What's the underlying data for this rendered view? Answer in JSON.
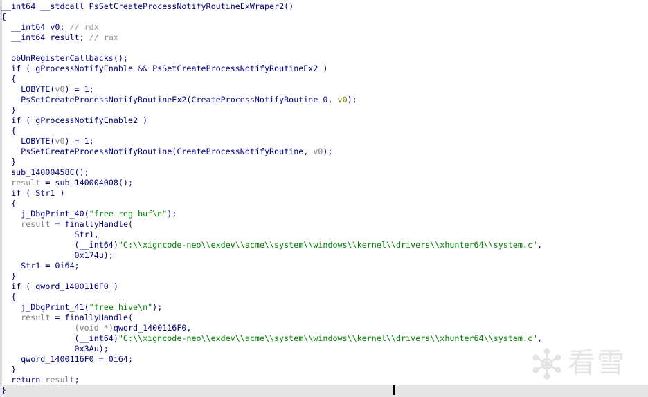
{
  "lines": [
    [
      [
        "k",
        "__int64 __stdcall PsSetCreateProcessNotifyRoutineExWraper2()"
      ]
    ],
    [
      [
        "k",
        "{"
      ]
    ],
    [
      [
        "k",
        "  __int64 v0; "
      ],
      [
        "c",
        "// rdx"
      ]
    ],
    [
      [
        "k",
        "  __int64 result; "
      ],
      [
        "c",
        "// rax"
      ]
    ],
    [
      [
        "k",
        ""
      ]
    ],
    [
      [
        "k",
        "  obUnRegisterCallbacks();"
      ]
    ],
    [
      [
        "k",
        "  if ( gProcessNotifyEnable && PsSetCreateProcessNotifyRoutineEx2 )"
      ]
    ],
    [
      [
        "k",
        "  {"
      ]
    ],
    [
      [
        "k",
        "    LOBYTE("
      ],
      [
        "v",
        "v0"
      ],
      [
        "k",
        ") = 1;"
      ]
    ],
    [
      [
        "k",
        "    PsSetCreateProcessNotifyRoutineEx2(CreateProcessNotifyRoutine_0, "
      ],
      [
        "n",
        "v0"
      ],
      [
        "k",
        ");"
      ]
    ],
    [
      [
        "k",
        "  }"
      ]
    ],
    [
      [
        "k",
        "  if ( gProcessNotifyEnable2 )"
      ]
    ],
    [
      [
        "k",
        "  {"
      ]
    ],
    [
      [
        "k",
        "    LOBYTE("
      ],
      [
        "v",
        "v0"
      ],
      [
        "k",
        ") = 1;"
      ]
    ],
    [
      [
        "k",
        "    PsSetCreateProcessNotifyRoutine(CreateProcessNotifyRoutine, "
      ],
      [
        "v",
        "v0"
      ],
      [
        "k",
        ");"
      ]
    ],
    [
      [
        "k",
        "  }"
      ]
    ],
    [
      [
        "k",
        "  sub_14000458C();"
      ]
    ],
    [
      [
        "k",
        "  "
      ],
      [
        "v",
        "result"
      ],
      [
        "k",
        " = sub_140004008();"
      ]
    ],
    [
      [
        "k",
        "  if ( Str1 )"
      ]
    ],
    [
      [
        "k",
        "  {"
      ]
    ],
    [
      [
        "k",
        "    j_DbgPrint_40("
      ],
      [
        "s",
        "\"free reg buf\\n\""
      ],
      [
        "k",
        ");"
      ]
    ],
    [
      [
        "k",
        "    "
      ],
      [
        "v",
        "result"
      ],
      [
        "k",
        " = finallyHandle("
      ]
    ],
    [
      [
        "k",
        "               Str1,"
      ]
    ],
    [
      [
        "k",
        "               (__int64)"
      ],
      [
        "s",
        "\"C:\\\\xigncode-neo\\\\exdev\\\\acme\\\\system\\\\windows\\\\kernel\\\\drivers\\\\xhunter64\\\\system.c\""
      ],
      [
        "k",
        ","
      ]
    ],
    [
      [
        "k",
        "               0x174u);"
      ]
    ],
    [
      [
        "k",
        "    Str1 = 0i64;"
      ]
    ],
    [
      [
        "k",
        "  }"
      ]
    ],
    [
      [
        "k",
        "  if ( qword_1400116F0 )"
      ]
    ],
    [
      [
        "k",
        "  {"
      ]
    ],
    [
      [
        "k",
        "    j_DbgPrint_41("
      ],
      [
        "s",
        "\"free hive\\n\""
      ],
      [
        "k",
        ");"
      ]
    ],
    [
      [
        "k",
        "    "
      ],
      [
        "v",
        "result"
      ],
      [
        "k",
        " = finallyHandle("
      ]
    ],
    [
      [
        "k",
        "               "
      ],
      [
        "v",
        "(void *)"
      ],
      [
        "k",
        "qword_1400116F0,"
      ]
    ],
    [
      [
        "k",
        "               (__int64)"
      ],
      [
        "s",
        "\"C:\\\\xigncode-neo\\\\exdev\\\\acme\\\\system\\\\windows\\\\kernel\\\\drivers\\\\xhunter64\\\\system.c\""
      ],
      [
        "k",
        ","
      ]
    ],
    [
      [
        "k",
        "               0x3Au);"
      ]
    ],
    [
      [
        "k",
        "    qword_1400116F0 = 0i64;"
      ]
    ],
    [
      [
        "k",
        "  }"
      ]
    ],
    [
      [
        "k",
        "  return "
      ],
      [
        "v",
        "result"
      ],
      [
        "k",
        ";"
      ]
    ],
    [
      [
        "k",
        "}"
      ]
    ]
  ],
  "watermark": {
    "text": "看雪",
    "icon": "snowflake-logo-icon"
  }
}
